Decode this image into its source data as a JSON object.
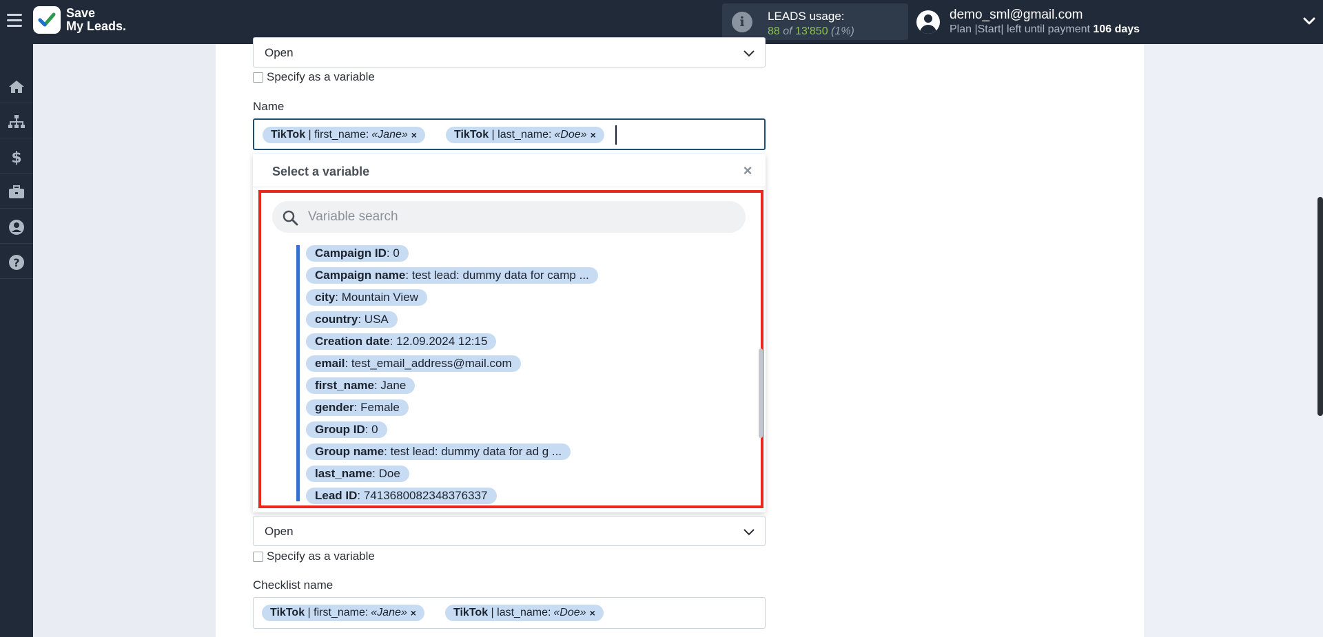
{
  "app": {
    "logo_line1": "Save",
    "logo_line2": "My Leads."
  },
  "usage": {
    "title": "LEADS usage:",
    "used": "88",
    "of_label": "of",
    "limit": "13'850",
    "percent": "(1%)"
  },
  "user": {
    "email": "demo_sml@gmail.com",
    "plan_text": "Plan |Start| left until payment",
    "days": "106 days"
  },
  "sidebar": {
    "items": [
      "home-icon",
      "sitemap-icon",
      "dollar-icon",
      "briefcase-icon",
      "user-circle-icon",
      "help-icon"
    ]
  },
  "form": {
    "select_top": {
      "value": "Open"
    },
    "specify_top": "Specify as a variable",
    "name_label": "Name",
    "name_tags": [
      {
        "source": "TikTok",
        "field": "first_name:",
        "value": "«Jane»",
        "remove": "×"
      },
      {
        "source": "TikTok",
        "field": "last_name:",
        "value": "«Doe»",
        "remove": "×"
      }
    ],
    "select_bottom": {
      "value": "Open"
    },
    "specify_bottom": "Specify as a variable",
    "checklist_label": "Checklist name",
    "checklist_tags": [
      {
        "source": "TikTok",
        "field": "first_name:",
        "value": "«Jane»",
        "remove": "×"
      },
      {
        "source": "TikTok",
        "field": "last_name:",
        "value": "«Doe»",
        "remove": "×"
      }
    ]
  },
  "variable_panel": {
    "title": "Select a variable",
    "close": "×",
    "search_placeholder": "Variable search",
    "items": [
      {
        "key": "Campaign ID",
        "value": ": 0"
      },
      {
        "key": "Campaign name",
        "value": ": test lead: dummy data for camp ..."
      },
      {
        "key": "city",
        "value": ": Mountain View"
      },
      {
        "key": "country",
        "value": ": USA"
      },
      {
        "key": "Creation date",
        "value": ": 12.09.2024 12:15"
      },
      {
        "key": "email",
        "value": ": test_email_address@mail.com"
      },
      {
        "key": "first_name",
        "value": ": Jane"
      },
      {
        "key": "gender",
        "value": ": Female"
      },
      {
        "key": "Group ID",
        "value": ": 0"
      },
      {
        "key": "Group name",
        "value": ": test lead: dummy data for ad g ..."
      },
      {
        "key": "last_name",
        "value": ": Doe"
      },
      {
        "key": "Lead ID",
        "value": ": 7413680082348376337"
      }
    ]
  },
  "colors": {
    "topbar": "#202a38",
    "accent_green": "#8bc34a",
    "tag_bg": "#c7dcf2",
    "highlight_red": "#e8281e",
    "list_bar": "#3a6fd0"
  }
}
